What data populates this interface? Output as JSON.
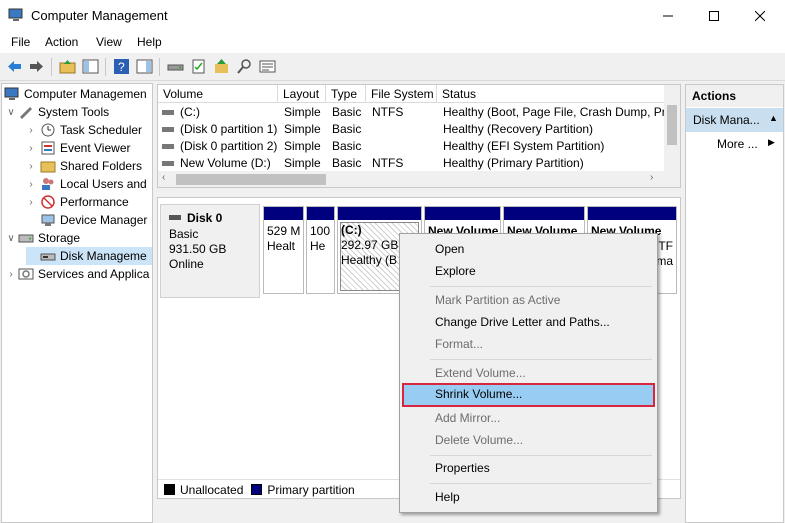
{
  "window": {
    "title": "Computer Management"
  },
  "menubar": [
    "File",
    "Action",
    "View",
    "Help"
  ],
  "tree": {
    "root": "Computer Managemen",
    "system_tools": "System Tools",
    "children_system": [
      "Task Scheduler",
      "Event Viewer",
      "Shared Folders",
      "Local Users and",
      "Performance",
      "Device Manager"
    ],
    "storage": "Storage",
    "disk_management": "Disk Manageme",
    "services": "Services and Applica"
  },
  "volume_list": {
    "columns": [
      "Volume",
      "Layout",
      "Type",
      "File System",
      "Status"
    ],
    "rows": [
      {
        "volume": "(C:)",
        "layout": "Simple",
        "type": "Basic",
        "fs": "NTFS",
        "status": "Healthy (Boot, Page File, Crash Dump, Pri"
      },
      {
        "volume": "(Disk 0 partition 1)",
        "layout": "Simple",
        "type": "Basic",
        "fs": "",
        "status": "Healthy (Recovery Partition)"
      },
      {
        "volume": "(Disk 0 partition 2)",
        "layout": "Simple",
        "type": "Basic",
        "fs": "",
        "status": "Healthy (EFI System Partition)"
      },
      {
        "volume": "New Volume (D:)",
        "layout": "Simple",
        "type": "Basic",
        "fs": "NTFS",
        "status": "Healthy (Primary Partition)"
      }
    ]
  },
  "disk": {
    "name": "Disk 0",
    "type": "Basic",
    "size": "931.50 GB",
    "state": "Online",
    "partitions": [
      {
        "line1": "529 M",
        "line2": "Healt"
      },
      {
        "line1": "100",
        "line2": "He"
      },
      {
        "title": "(C:)",
        "line1": "292.97 GB N",
        "line2": "Healthy (B"
      },
      {
        "title": "New Volume"
      },
      {
        "title": "New Volume"
      },
      {
        "title": "New Volume",
        "line1": "TF",
        "line2": "ma"
      }
    ]
  },
  "legend": {
    "unallocated": "Unallocated",
    "primary": "Primary partition"
  },
  "actions": {
    "header": "Actions",
    "group": "Disk Mana...",
    "more": "More ..."
  },
  "context_menu": {
    "open": "Open",
    "explore": "Explore",
    "mark_active": "Mark Partition as Active",
    "change_letter": "Change Drive Letter and Paths...",
    "format": "Format...",
    "extend": "Extend Volume...",
    "shrink": "Shrink Volume...",
    "add_mirror": "Add Mirror...",
    "delete": "Delete Volume...",
    "properties": "Properties",
    "help": "Help"
  },
  "colors": {
    "primary_partition": "#00007f",
    "selection": "#99ccf3",
    "highlight_border": "#d7263d",
    "actions_group": "#c9dff0"
  }
}
